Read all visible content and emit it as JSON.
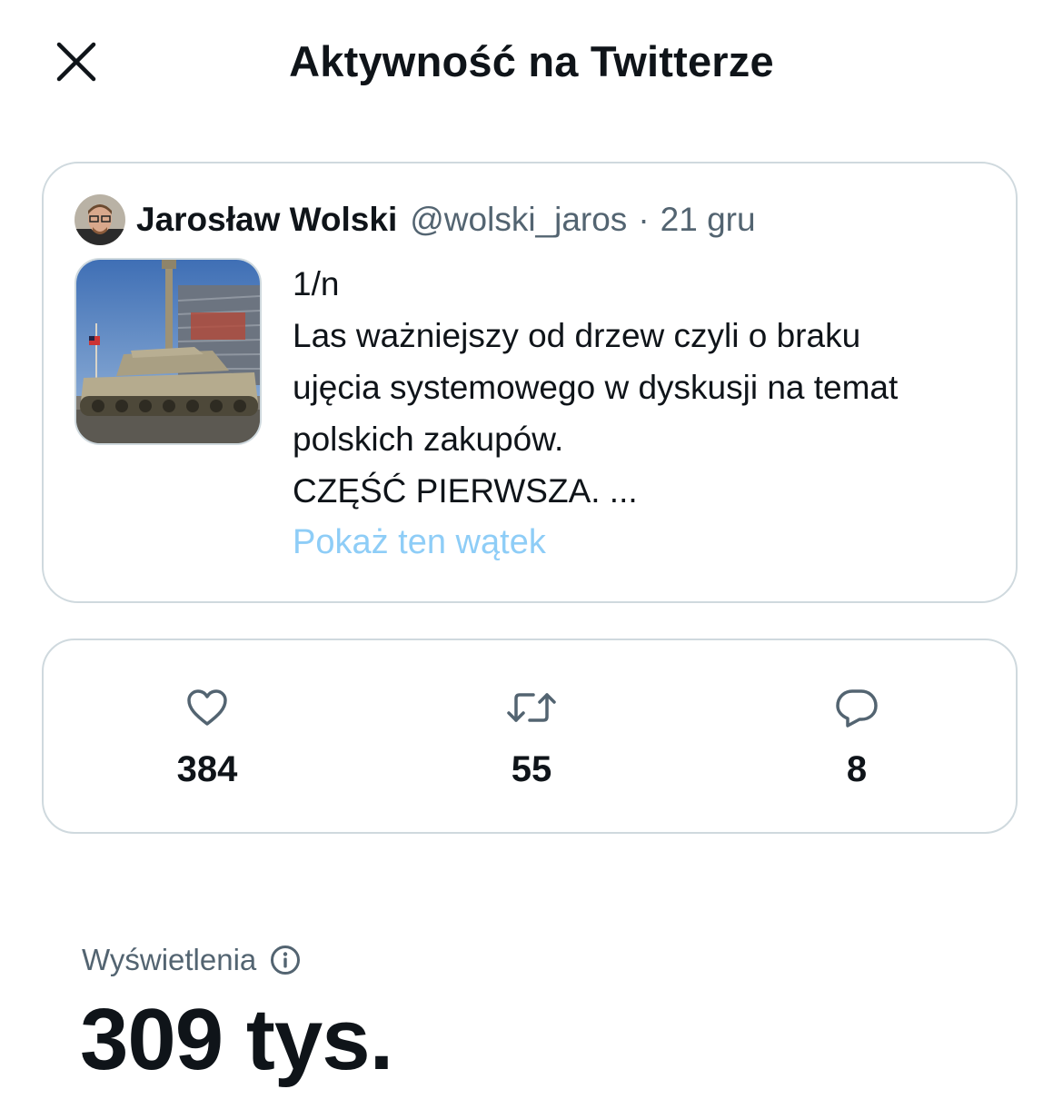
{
  "header": {
    "title": "Aktywność na Twitterze",
    "close_icon": "close-icon"
  },
  "tweet": {
    "author_name": "Jarosław Wolski",
    "author_handle": "@wolski_jaros",
    "separator": "·",
    "date": "21 gru",
    "text_lines": [
      "1/n",
      "Las ważniejszy od drzew czyli o braku",
      "ujęcia systemowego w dyskusji na temat",
      "polskich zakupów.",
      "CZĘŚĆ PIERWSZA. ..."
    ],
    "show_thread_label": "Pokaż ten wątek",
    "link_color": "#8ecdf7"
  },
  "stats": [
    {
      "icon": "heart-icon",
      "count": "384"
    },
    {
      "icon": "retweet-icon",
      "count": "55"
    },
    {
      "icon": "reply-icon",
      "count": "8"
    }
  ],
  "views": {
    "label": "Wyświetlenia",
    "info_icon": "info-icon",
    "value": "309 tys."
  }
}
